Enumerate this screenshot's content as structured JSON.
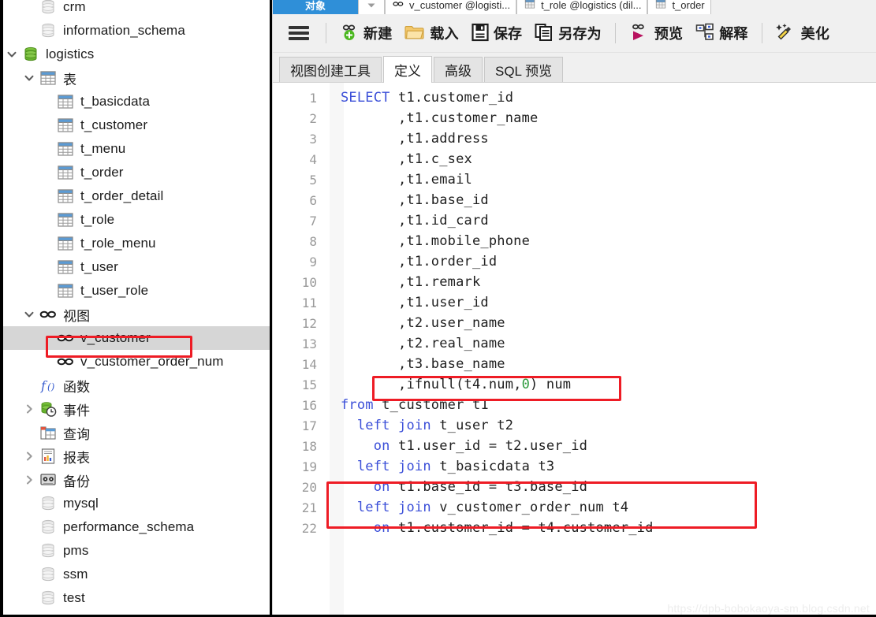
{
  "window": {
    "watermark": "https://dpb-bobokaoya-sm.blog.csdn.net"
  },
  "sidebar": {
    "tree": [
      {
        "label": "crm",
        "icon": "database-gray-icon",
        "indent": 1,
        "twisty": "none",
        "selected": false
      },
      {
        "label": "information_schema",
        "icon": "database-gray-icon",
        "indent": 1,
        "twisty": "none",
        "selected": false
      },
      {
        "label": "logistics",
        "icon": "database-green-icon",
        "indent": 0,
        "twisty": "expanded",
        "selected": false
      },
      {
        "label": "表",
        "icon": "table-group-icon",
        "indent": 1,
        "twisty": "expanded",
        "selected": false
      },
      {
        "label": "t_basicdata",
        "icon": "table-icon",
        "indent": 2,
        "twisty": "none",
        "selected": false
      },
      {
        "label": "t_customer",
        "icon": "table-icon",
        "indent": 2,
        "twisty": "none",
        "selected": false
      },
      {
        "label": "t_menu",
        "icon": "table-icon",
        "indent": 2,
        "twisty": "none",
        "selected": false
      },
      {
        "label": "t_order",
        "icon": "table-icon",
        "indent": 2,
        "twisty": "none",
        "selected": false
      },
      {
        "label": "t_order_detail",
        "icon": "table-icon",
        "indent": 2,
        "twisty": "none",
        "selected": false
      },
      {
        "label": "t_role",
        "icon": "table-icon",
        "indent": 2,
        "twisty": "none",
        "selected": false
      },
      {
        "label": "t_role_menu",
        "icon": "table-icon",
        "indent": 2,
        "twisty": "none",
        "selected": false
      },
      {
        "label": "t_user",
        "icon": "table-icon",
        "indent": 2,
        "twisty": "none",
        "selected": false
      },
      {
        "label": "t_user_role",
        "icon": "table-icon",
        "indent": 2,
        "twisty": "none",
        "selected": false
      },
      {
        "label": "视图",
        "icon": "view-icon",
        "indent": 1,
        "twisty": "expanded",
        "selected": false
      },
      {
        "label": "v_customer",
        "icon": "view-icon",
        "indent": 2,
        "twisty": "none",
        "selected": true
      },
      {
        "label": "v_customer_order_num",
        "icon": "view-icon",
        "indent": 2,
        "twisty": "none",
        "selected": false
      },
      {
        "label": "函数",
        "icon": "function-icon",
        "indent": 1,
        "twisty": "none",
        "selected": false
      },
      {
        "label": "事件",
        "icon": "event-icon",
        "indent": 1,
        "twisty": "collapsed",
        "selected": false
      },
      {
        "label": "查询",
        "icon": "query-icon",
        "indent": 1,
        "twisty": "none",
        "selected": false
      },
      {
        "label": "报表",
        "icon": "report-icon",
        "indent": 1,
        "twisty": "collapsed",
        "selected": false
      },
      {
        "label": "备份",
        "icon": "backup-icon",
        "indent": 1,
        "twisty": "collapsed",
        "selected": false
      },
      {
        "label": "mysql",
        "icon": "database-gray-icon",
        "indent": 1,
        "twisty": "none",
        "selected": false
      },
      {
        "label": "performance_schema",
        "icon": "database-gray-icon",
        "indent": 1,
        "twisty": "none",
        "selected": false
      },
      {
        "label": "pms",
        "icon": "database-gray-icon",
        "indent": 1,
        "twisty": "none",
        "selected": false
      },
      {
        "label": "ssm",
        "icon": "database-gray-icon",
        "indent": 1,
        "twisty": "none",
        "selected": false
      },
      {
        "label": "test",
        "icon": "database-gray-icon",
        "indent": 1,
        "twisty": "none",
        "selected": false
      }
    ],
    "annotation": {
      "color": "#ee1c25",
      "target": "v_customer"
    }
  },
  "doc_tabs": [
    {
      "label": "对象",
      "icon": "object-icon",
      "active": true
    },
    {
      "label": "v_customer @logisti...",
      "icon": "view-icon",
      "active": false
    },
    {
      "label": "t_role @logistics (dil...",
      "icon": "table-icon",
      "active": false
    },
    {
      "label": "t_order",
      "icon": "table-icon",
      "active": false
    }
  ],
  "toolbar": {
    "menu_icon": "hamburger-icon",
    "buttons": [
      {
        "label": "新建",
        "icon": "new-view-icon"
      },
      {
        "label": "载入",
        "icon": "folder-open-icon"
      },
      {
        "label": "保存",
        "icon": "save-disk-icon"
      },
      {
        "label": "另存为",
        "icon": "save-as-icon"
      },
      {
        "label": "预览",
        "icon": "preview-icon"
      },
      {
        "label": "解释",
        "icon": "explain-icon"
      },
      {
        "label": "美化",
        "icon": "beautify-icon"
      }
    ]
  },
  "subtabs": [
    {
      "label": "视图创建工具",
      "active": false
    },
    {
      "label": "定义",
      "active": true
    },
    {
      "label": "高级",
      "active": false
    },
    {
      "label": "SQL 预览",
      "active": false
    }
  ],
  "editor": {
    "lines": [
      {
        "n": "1",
        "text": "SELECT t1.customer_id",
        "kw": "SELECT"
      },
      {
        "n": "2",
        "text": "       ,t1.customer_name",
        "kw": ""
      },
      {
        "n": "3",
        "text": "       ,t1.address",
        "kw": ""
      },
      {
        "n": "4",
        "text": "       ,t1.c_sex",
        "kw": ""
      },
      {
        "n": "5",
        "text": "       ,t1.email",
        "kw": ""
      },
      {
        "n": "6",
        "text": "       ,t1.base_id",
        "kw": ""
      },
      {
        "n": "7",
        "text": "       ,t1.id_card",
        "kw": ""
      },
      {
        "n": "8",
        "text": "       ,t1.mobile_phone",
        "kw": ""
      },
      {
        "n": "9",
        "text": "       ,t1.order_id",
        "kw": ""
      },
      {
        "n": "10",
        "text": "       ,t1.remark",
        "kw": ""
      },
      {
        "n": "11",
        "text": "       ,t1.user_id",
        "kw": ""
      },
      {
        "n": "12",
        "text": "       ,t2.user_name",
        "kw": ""
      },
      {
        "n": "13",
        "text": "       ,t2.real_name",
        "kw": ""
      },
      {
        "n": "14",
        "text": "       ,t3.base_name",
        "kw": ""
      },
      {
        "n": "15",
        "text": "       ,ifnull(t4.num,0) num",
        "kw": ""
      },
      {
        "n": "16",
        "text": "from t_customer t1",
        "kw": "from"
      },
      {
        "n": "17",
        "text": "  left join t_user t2",
        "kw": "left join"
      },
      {
        "n": "18",
        "text": "    on t1.user_id = t2.user_id",
        "kw": "on"
      },
      {
        "n": "19",
        "text": "  left join t_basicdata t3",
        "kw": "left join"
      },
      {
        "n": "20",
        "text": "    on t1.base_id = t3.base_id",
        "kw": "on"
      },
      {
        "n": "21",
        "text": "  left join v_customer_order_num t4",
        "kw": "left join"
      },
      {
        "n": "22",
        "text": "    on t1.customer_id = t4.customer_id",
        "kw": "on"
      }
    ],
    "annotations": [
      {
        "lines": "15",
        "color": "#ee1c25"
      },
      {
        "lines": "21-22",
        "color": "#ee1c25"
      }
    ]
  },
  "colors": {
    "keyword": "#3b4fd8",
    "numeric": "#2e9b3e",
    "accent_tab": "#2f8fd8",
    "annotation": "#ee1c25",
    "selection": "#d6d6d6"
  }
}
